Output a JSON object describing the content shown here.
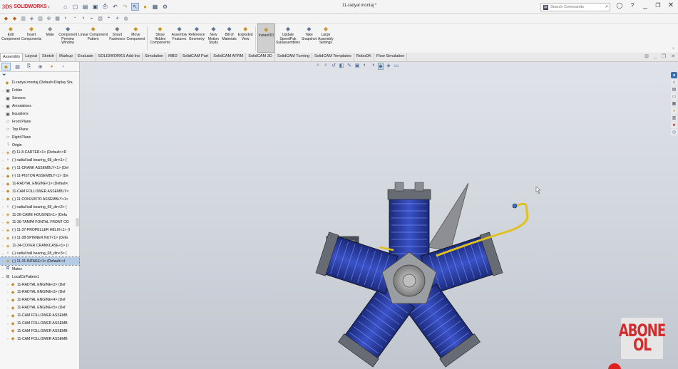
{
  "app": {
    "brand_ds": "3DS",
    "brand_name": "SOLIDWORKS"
  },
  "document_title": "11-radyal montaj *",
  "search": {
    "placeholder": "Search Commands"
  },
  "commands": [
    {
      "label": "Edit\nComponent",
      "icon": "edit-component-icon",
      "color": "#c9962b"
    },
    {
      "label": "Insert\nComponents",
      "icon": "insert-components-icon",
      "color": "#c9962b"
    },
    {
      "label": "Mate",
      "icon": "mate-icon",
      "color": "#8a8a8a"
    },
    {
      "label": "Component\nPreview\nWindow",
      "icon": "preview-window-icon",
      "color": "#5d7599"
    },
    {
      "label": "Linear Component\nPattern",
      "icon": "linear-pattern-icon",
      "color": "#c9962b"
    },
    {
      "label": "Smart\nFasteners",
      "icon": "smart-fasteners-icon",
      "color": "#777"
    },
    {
      "label": "Move\nComponent",
      "icon": "move-component-icon",
      "color": "#c9962b"
    },
    {
      "label": "Show\nHidden\nComponents",
      "icon": "show-hidden-icon",
      "color": "#c9962b"
    },
    {
      "label": "Assembly\nFeatures",
      "icon": "assembly-features-icon",
      "color": "#5d7599"
    },
    {
      "label": "Reference\nGeometry",
      "icon": "reference-geometry-icon",
      "color": "#5d7599"
    },
    {
      "label": "New\nMotion\nStudy",
      "icon": "motion-study-icon",
      "color": "#5d7599"
    },
    {
      "label": "Bill of\nMaterials",
      "icon": "bom-icon",
      "color": "#5d7599"
    },
    {
      "label": "Exploded\nView",
      "icon": "exploded-view-icon",
      "color": "#c9962b"
    },
    {
      "label": "Instant3D",
      "icon": "instant3d-icon",
      "color": "#c9962b"
    },
    {
      "label": "Update\nSpeedPak\nSubassemblies",
      "icon": "speedpak-icon",
      "color": "#5d7599"
    },
    {
      "label": "Take\nSnapshot",
      "icon": "snapshot-icon",
      "color": "#5d7599"
    },
    {
      "label": "Large\nAssembly\nSettings",
      "icon": "large-assembly-icon",
      "color": "#c9962b"
    }
  ],
  "tabs": [
    "Assembly",
    "Layout",
    "Sketch",
    "Markup",
    "Evaluate",
    "SOLIDWORKS Add-Ins",
    "Simulation",
    "MBD",
    "SolidCAM Part",
    "SolidCAM AFRM",
    "SolidCAM 3D",
    "SolidCAM Turning",
    "SolidCAM Templates",
    "RoboDK",
    "Flow Simulation"
  ],
  "tree": [
    {
      "label": "11-radyal montaj  (Default<Display Sta",
      "icon": "assembly",
      "indent": 0,
      "exp": ""
    },
    {
      "label": "Folder",
      "icon": "feat",
      "indent": 1,
      "exp": "›"
    },
    {
      "label": "Sensors",
      "icon": "feat",
      "indent": 1,
      "exp": ""
    },
    {
      "label": "Annotations",
      "icon": "feat",
      "indent": 1,
      "exp": "›"
    },
    {
      "label": "Equations",
      "icon": "feat",
      "indent": 1,
      "exp": ""
    },
    {
      "label": "Front Plane",
      "icon": "plane",
      "indent": 1,
      "exp": ""
    },
    {
      "label": "Top Plane",
      "icon": "plane",
      "indent": 1,
      "exp": ""
    },
    {
      "label": "Right Plane",
      "icon": "plane",
      "indent": 1,
      "exp": ""
    },
    {
      "label": "Origin",
      "icon": "origin",
      "indent": 1,
      "exp": ""
    },
    {
      "label": "(f) 11-8-CARTER<1> (Default<<D",
      "icon": "part",
      "indent": 1,
      "exp": "›"
    },
    {
      "label": "(-) radial ball bearing_68_din<1> (",
      "icon": "bearing",
      "indent": 1,
      "exp": "›"
    },
    {
      "label": "(-) 11-CRANK ASSEMBLY<1> (Def",
      "icon": "assembly",
      "indent": 1,
      "exp": "›"
    },
    {
      "label": "(-) 11-PISTON ASSEMBLY<1> (De",
      "icon": "assembly",
      "indent": 1,
      "exp": "›"
    },
    {
      "label": "11-RADYAL ENGINE<1> (Default<",
      "icon": "assembly",
      "indent": 1,
      "exp": "›"
    },
    {
      "label": "11-CAM FOLLOWER ASSEMBLY<",
      "icon": "assembly",
      "indent": 1,
      "exp": "›"
    },
    {
      "label": "(-) 11-CONJUNTO ASSEMBLY<1>",
      "icon": "assembly",
      "indent": 1,
      "exp": "›"
    },
    {
      "label": "(-) radial ball bearing_68_din<2> (",
      "icon": "bearing",
      "indent": 1,
      "exp": "›"
    },
    {
      "label": "11-26-CAME HOUSING<1> (Defa",
      "icon": "part",
      "indent": 1,
      "exp": "›"
    },
    {
      "label": "11-36-TAMPA FONTAL FRONT CO",
      "icon": "part",
      "indent": 1,
      "exp": "›"
    },
    {
      "label": "(-) 11-37-PROPELLER HELIX<1> (I",
      "icon": "part",
      "indent": 1,
      "exp": "›"
    },
    {
      "label": "(-) 11-38-SPINNER NUT<1> (Defa",
      "icon": "part",
      "indent": 1,
      "exp": "›"
    },
    {
      "label": "11-34-COVER  CRANKCASE<1> (I",
      "icon": "part",
      "indent": 1,
      "exp": "›"
    },
    {
      "label": "(-) radial ball bearing_68_din<3> (",
      "icon": "bearing",
      "indent": 1,
      "exp": "›"
    },
    {
      "label": "(-) 11-31-INTAKE<1> (Default<<I",
      "icon": "part",
      "indent": 1,
      "exp": "›",
      "selected": true
    },
    {
      "label": "Mates",
      "icon": "mates",
      "indent": 1,
      "exp": "›"
    },
    {
      "label": "LocalCirPattern1",
      "icon": "pattern",
      "indent": 1,
      "exp": "⌄"
    },
    {
      "label": "11-RADYAL ENGINE<2> (Def",
      "icon": "assembly",
      "indent": 2,
      "exp": "›"
    },
    {
      "label": "11-RADYAL ENGINE<3> (Def",
      "icon": "assembly",
      "indent": 2,
      "exp": "›"
    },
    {
      "label": "11-RADYAL ENGINE<4> (Def",
      "icon": "assembly",
      "indent": 2,
      "exp": "›"
    },
    {
      "label": "11-RADYAL ENGINE<5> (Def",
      "icon": "assembly",
      "indent": 2,
      "exp": "›"
    },
    {
      "label": "11-CAM FOLLOWER ASSEMB",
      "icon": "assembly",
      "indent": 2,
      "exp": "›"
    },
    {
      "label": "11-CAM FOLLOWER ASSEMB",
      "icon": "assembly",
      "indent": 2,
      "exp": "›"
    },
    {
      "label": "11-CAM FOLLOWER ASSEMB",
      "icon": "assembly",
      "indent": 2,
      "exp": "›"
    },
    {
      "label": "11-CAM FOLLOWER ASSEMB",
      "icon": "assembly",
      "indent": 2,
      "exp": "›"
    }
  ],
  "watermark": {
    "line1": "ABONE",
    "line2": "OL",
    "color": "#d42c2c"
  },
  "colors": {
    "accent": "#2c5aa0",
    "brand_red": "#d0202a",
    "cylinder_blue": "#2a3ea8"
  }
}
